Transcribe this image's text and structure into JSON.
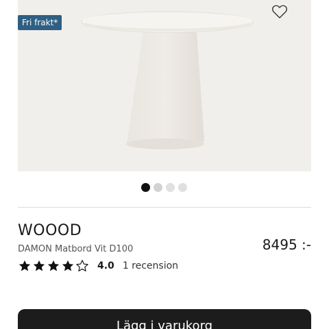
{
  "badge": {
    "label": "Fri frakt*"
  },
  "carousel": {
    "count": 4,
    "active_index": 0
  },
  "product": {
    "brand": "WOOOD",
    "name": "DAMON Matbord Vit D100",
    "price": "8495 :-"
  },
  "rating": {
    "value": "4.0",
    "stars": 4,
    "max_stars": 5,
    "reviews": "1 recension"
  },
  "cart": {
    "button_label": "Lägg i varukorg"
  },
  "colors": {
    "badge_bg": "#2f5f82",
    "button_bg": "#1c1c1c",
    "hero_bg": "#f1efec",
    "dot_active": "#111111"
  },
  "icons": [
    "heart-outline-icon",
    "star-filled-icon",
    "star-outline-icon"
  ]
}
